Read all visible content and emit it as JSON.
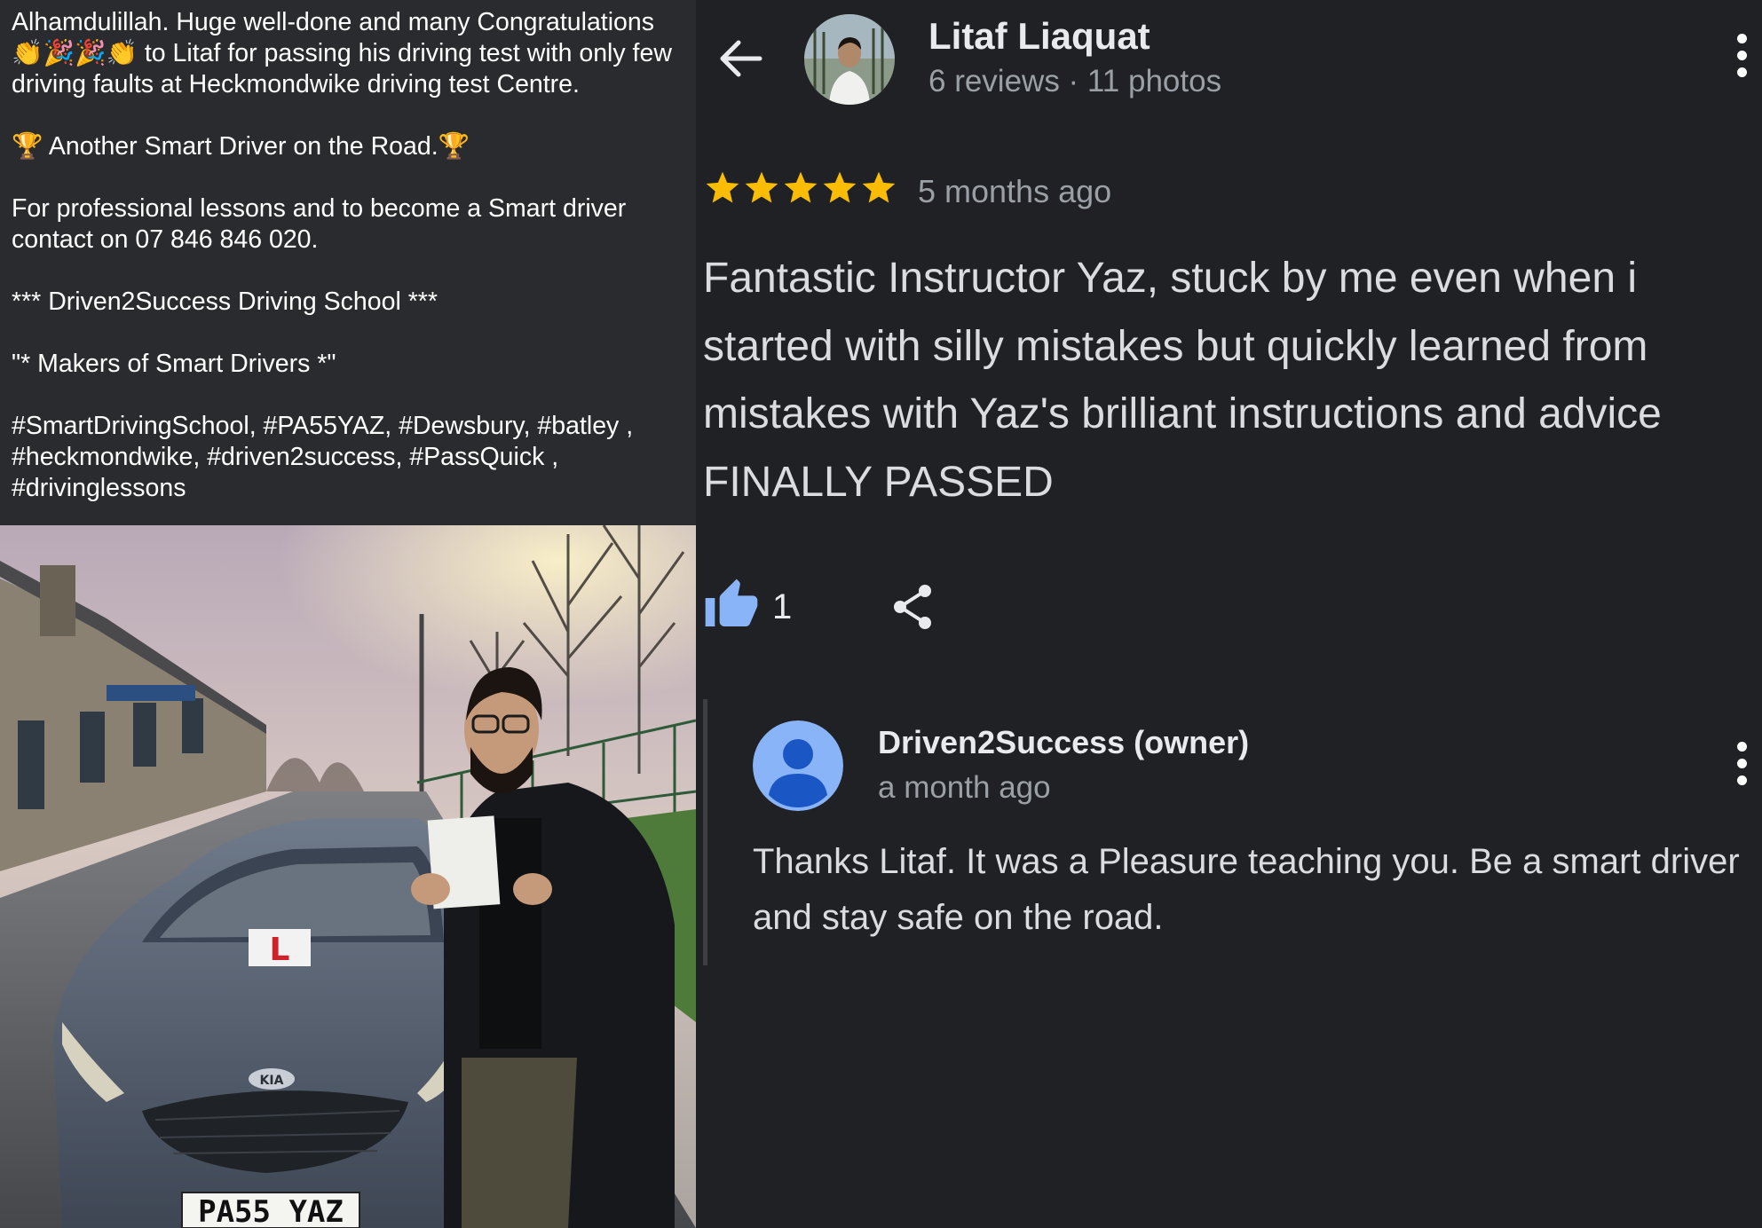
{
  "post": {
    "paragraphs": [
      "Alhamdulillah. Huge well-done and many Congratulations 👏🎉🎉👏 to Litaf for passing his driving test with only few driving faults at Heckmondwike driving test Centre.",
      "🏆 Another Smart Driver on the Road.🏆",
      "For professional lessons and to become a Smart driver contact on 07 846 846 020.",
      "*** Driven2Success Driving School ***",
      "\"* Makers of Smart Drivers *\"",
      "#SmartDrivingSchool, #PA55YAZ, #Dewsbury, #batley , #heckmondwike, #driven2success, #PassQuick , #drivinglessons"
    ],
    "photo": {
      "plate": "PA55 YAZ",
      "badge": "KIA",
      "l_plate": "L"
    }
  },
  "review": {
    "reviewer_name": "Litaf Liaquat",
    "reviewer_meta": "6 reviews · 11 photos",
    "rating": 5,
    "date": "5 months ago",
    "text": "Fantastic Instructor Yaz, stuck by me even when i started with silly mistakes but quickly learned from mistakes with Yaz's brilliant instructions and advice FINALLY PASSED",
    "like_count": "1",
    "icons": {
      "back": "arrow-left-icon",
      "more": "more-vert-icon",
      "like": "thumb-up-icon",
      "share": "share-icon",
      "star": "star-icon"
    },
    "colors": {
      "star": "#fbbc04",
      "like": "#8ab4f8",
      "owner_avatar_bg": "#8ab4f8"
    }
  },
  "reply": {
    "owner_name": "Driven2Success (owner)",
    "date": "a month ago",
    "text": "Thanks Litaf. It was a Pleasure teaching you. Be a smart driver and stay safe on the road."
  }
}
